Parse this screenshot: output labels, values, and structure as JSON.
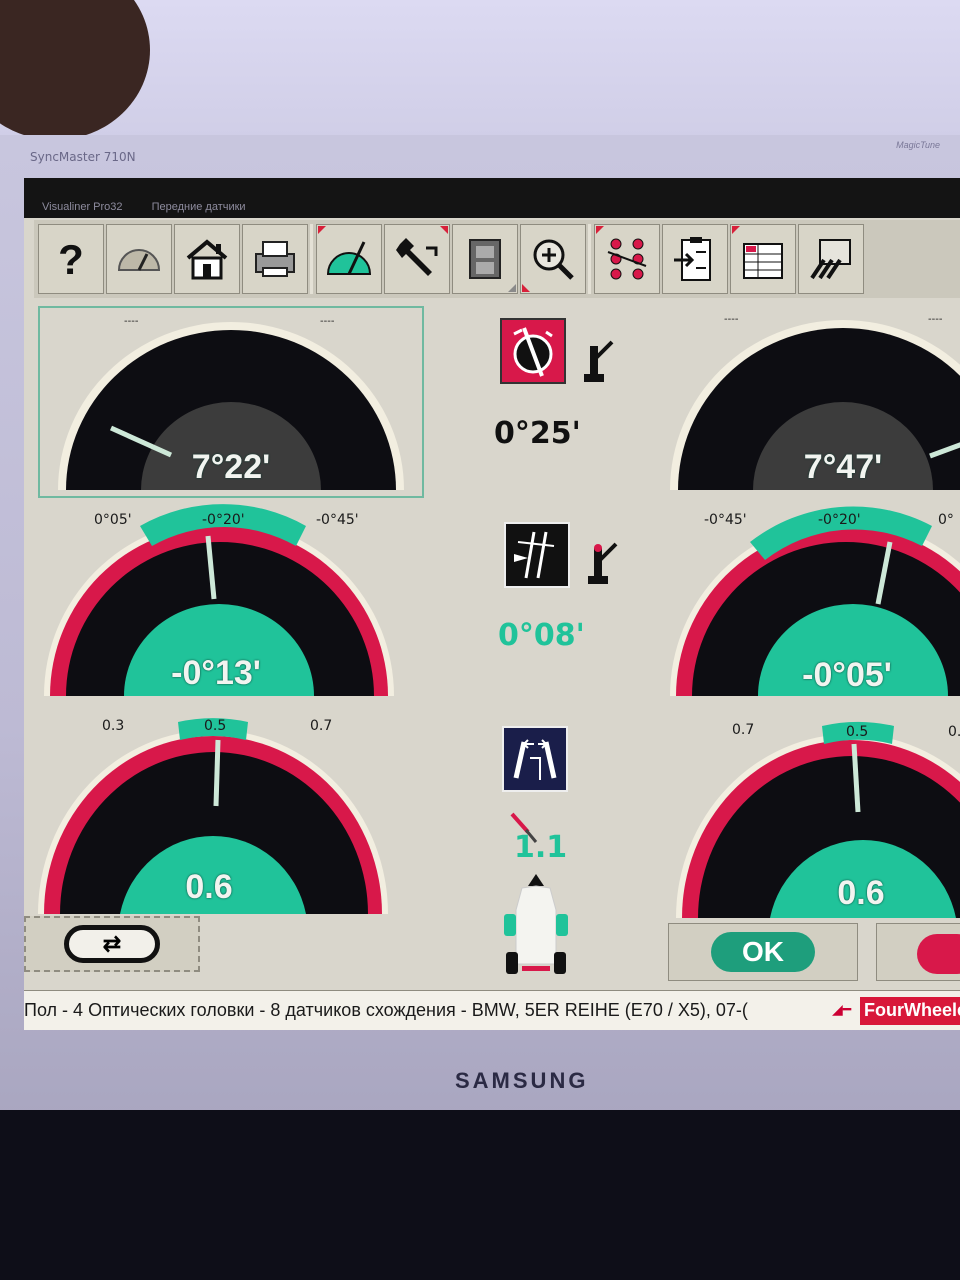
{
  "monitor": {
    "model": "SyncMaster 710N",
    "brand": "SAMSUNG",
    "tm": "MagicTune"
  },
  "window": {
    "app_title": "Visualiner Pro32",
    "screen_title": "Передние датчики"
  },
  "toolbar": {
    "buttons": [
      {
        "name": "help",
        "label": "?"
      },
      {
        "name": "gauge"
      },
      {
        "name": "home"
      },
      {
        "name": "print"
      },
      {
        "name": "measure"
      },
      {
        "name": "adjust"
      },
      {
        "name": "film"
      },
      {
        "name": "zoom"
      },
      {
        "name": "points"
      },
      {
        "name": "clipboard"
      },
      {
        "name": "table"
      },
      {
        "name": "sensors"
      }
    ]
  },
  "caster": {
    "left": {
      "value": "7°22'",
      "dash_left": "----",
      "dash_right": "----"
    },
    "right": {
      "value": "7°47'",
      "dash_left": "----",
      "dash_right": "----"
    },
    "cross": "0°25'"
  },
  "camber": {
    "left": {
      "min": "0°05'",
      "target": "-0°20'",
      "max": "-0°45'",
      "value": "-0°13'"
    },
    "right": {
      "min": "-0°45'",
      "target": "-0°20'",
      "max": "0°",
      "value": "-0°05'"
    },
    "cross": "0°08'"
  },
  "toe": {
    "left": {
      "min": "0.3",
      "target": "0.5",
      "max": "0.7",
      "value": "0.6"
    },
    "right": {
      "min": "0.7",
      "target": "0.5",
      "max": "0.",
      "value": "0.6"
    },
    "total": "1.1"
  },
  "buttons": {
    "ok": "OK"
  },
  "status": {
    "text": "Пол - 4 Оптических головки - 8 датчиков схождения - BMW, 5ER REIHE (E70 / X5), 07-(",
    "logo": "FourWheeler"
  },
  "colors": {
    "teal": "#20c39a",
    "red": "#d8184a",
    "black": "#0d0d12"
  }
}
